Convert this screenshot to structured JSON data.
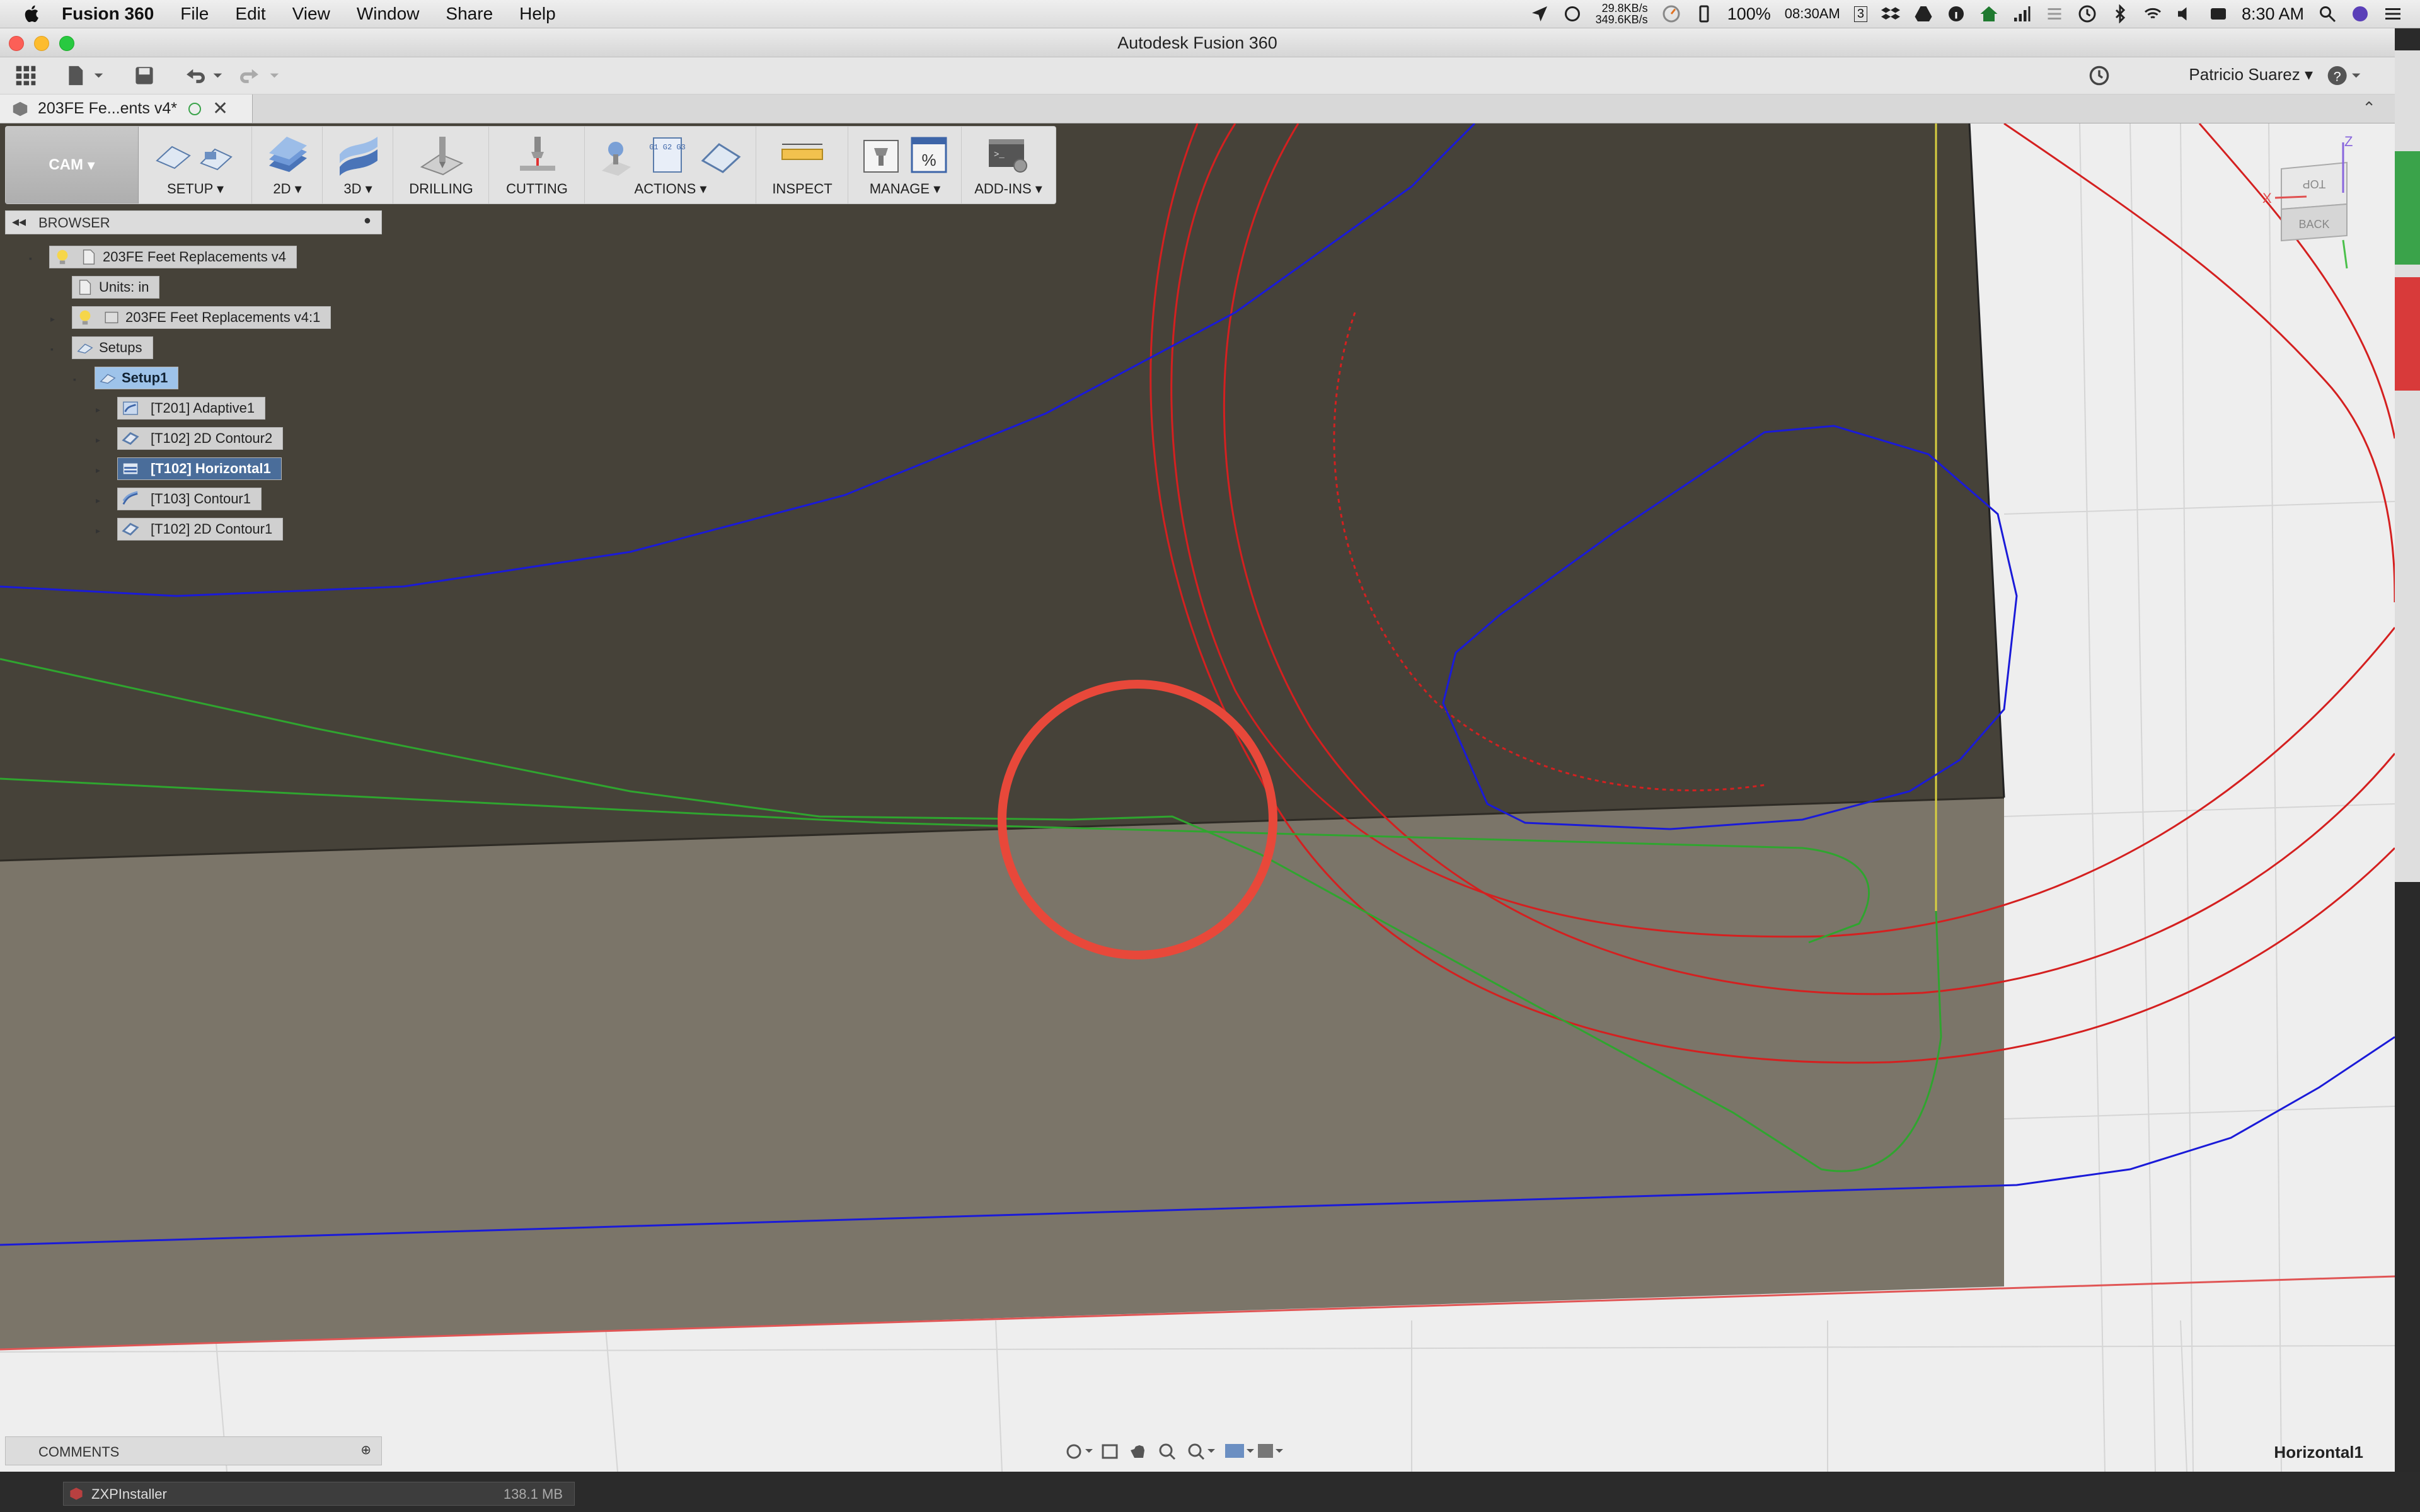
{
  "menubar": {
    "app_name": "Fusion 360",
    "items": [
      "File",
      "Edit",
      "View",
      "Window",
      "Share",
      "Help"
    ],
    "net_up": "29.8KB/s",
    "net_down": "349.6KB/s",
    "battery": "100%",
    "clock_small": "08:30AM",
    "badge": "3",
    "time": "8:30 AM"
  },
  "window": {
    "title": "Autodesk Fusion 360"
  },
  "apptoolbar": {
    "user": "Patricio Suarez",
    "help": "?"
  },
  "document": {
    "tab_label": "203FE Fe...ents v4*"
  },
  "cam_toolbar": {
    "workspace": "CAM",
    "groups": [
      "SETUP",
      "2D",
      "3D",
      "DRILLING",
      "CUTTING",
      "ACTIONS",
      "INSPECT",
      "MANAGE",
      "ADD-INS"
    ],
    "actions_icon_text": "G1 G2 G3"
  },
  "browser": {
    "title": "BROWSER",
    "root": "203FE Feet Replacements v4",
    "units": "Units: in",
    "body": "203FE Feet Replacements v4:1",
    "setups": "Setups",
    "setup": "Setup1",
    "operations": [
      "[T201] Adaptive1",
      "[T102] 2D Contour2",
      "[T102] Horizontal1",
      "[T103] Contour1",
      "[T102] 2D Contour1"
    ]
  },
  "viewcube": {
    "top": "TOP",
    "back": "BACK",
    "z": "Z",
    "x": "X"
  },
  "comments": {
    "title": "COMMENTS"
  },
  "statusbar": {
    "active_operation": "Horizontal1"
  },
  "dock": {
    "item": "ZXPInstaller",
    "size": "138.1 MB"
  },
  "colors": {
    "stock_top": "#464239",
    "stock_front": "#7b7569",
    "toolpath_blue": "#1a1ad8",
    "toolpath_red": "#d42020",
    "toolpath_green": "#2fa52f",
    "annotation_circle": "#e8483a"
  }
}
